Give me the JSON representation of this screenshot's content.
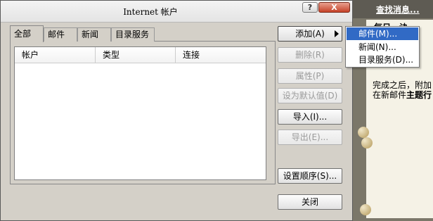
{
  "window": {
    "title": "Internet 帐户"
  },
  "titlebar_buttons": {
    "help": "?",
    "close": "X"
  },
  "tabs": [
    "全部",
    "邮件",
    "新闻",
    "目录服务"
  ],
  "active_tab": "全部",
  "list": {
    "columns": [
      "帐户",
      "类型",
      "连接"
    ],
    "rows": []
  },
  "buttons": {
    "add": "添加(A)",
    "remove": "删除(R)",
    "properties": "属性(P)",
    "set_default": "设为默认值(D)",
    "import": "导入(I)...",
    "export": "导出(E)...",
    "set_order": "设置顺序(S)...",
    "close": "关闭"
  },
  "add_menu": {
    "items": [
      "邮件(M)...",
      "新闻(N)...",
      "目录服务(D)..."
    ],
    "highlighted": "邮件(M)..."
  },
  "background": {
    "link": "查找消息...",
    "heading": "每日一诀",
    "text_line1": "完成之后，附加",
    "text_line2_prefix": "在新邮件",
    "text_line2_bold": "主题行"
  },
  "colors": {
    "menu_highlight": "#316ac5",
    "dialog_face": "#d4d0c8"
  }
}
